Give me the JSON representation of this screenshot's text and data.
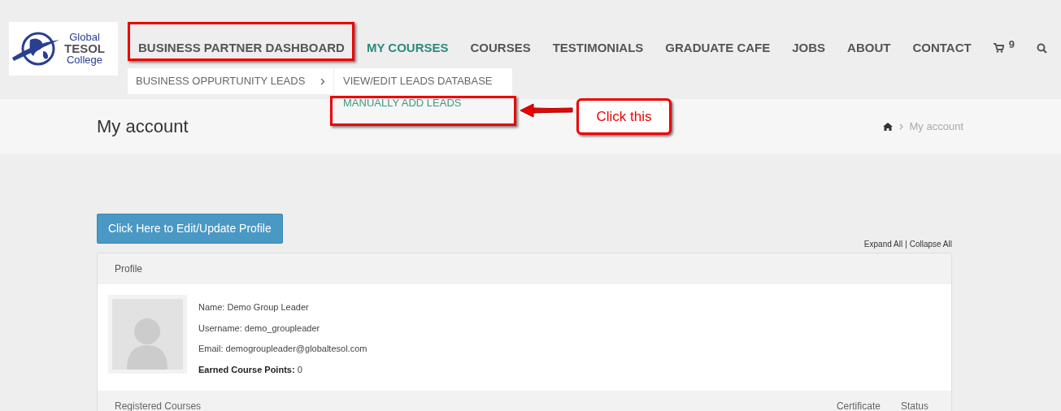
{
  "logo": {
    "line_1": "Global",
    "line_2": "TESOL",
    "line_3": "College"
  },
  "nav": [
    {
      "label": "BUSINESS PARTNER DASHBOARD",
      "selected": false
    },
    {
      "label": "MY COURSES",
      "selected": true
    },
    {
      "label": "COURSES",
      "selected": false
    },
    {
      "label": "TESTIMONIALS",
      "selected": false
    },
    {
      "label": "GRADUATE CAFE",
      "selected": false
    },
    {
      "label": "JOBS",
      "selected": false
    },
    {
      "label": "ABOUT",
      "selected": false
    },
    {
      "label": "CONTACT",
      "selected": false
    }
  ],
  "cart_count": "9",
  "submenu": [
    {
      "label": "BUSINESS OPPURTUNITY LEADS"
    }
  ],
  "subsubmenu": [
    {
      "label": "VIEW/EDIT LEADS DATABASE",
      "selected": false
    },
    {
      "label": "MANUALLY ADD LEADS",
      "selected": true
    }
  ],
  "annotation": {
    "callout": "Click this"
  },
  "page_title": "My account",
  "breadcrumb": [
    "My account"
  ],
  "edit_button": "Click Here to Edit/Update Profile",
  "expand_links": [
    "Expand All",
    "Collapse All"
  ],
  "expand_separator": "|",
  "profile": {
    "heading": "Profile",
    "fields": [
      "Name: Demo Group Leader",
      "Username: demo_groupleader",
      "Email: demogroupleader@globaltesol.com",
      "**Earned Course Points:** 0"
    ]
  },
  "courses": {
    "heading": "Registered Courses",
    "columns": [
      "Certificate",
      "Status"
    ]
  }
}
